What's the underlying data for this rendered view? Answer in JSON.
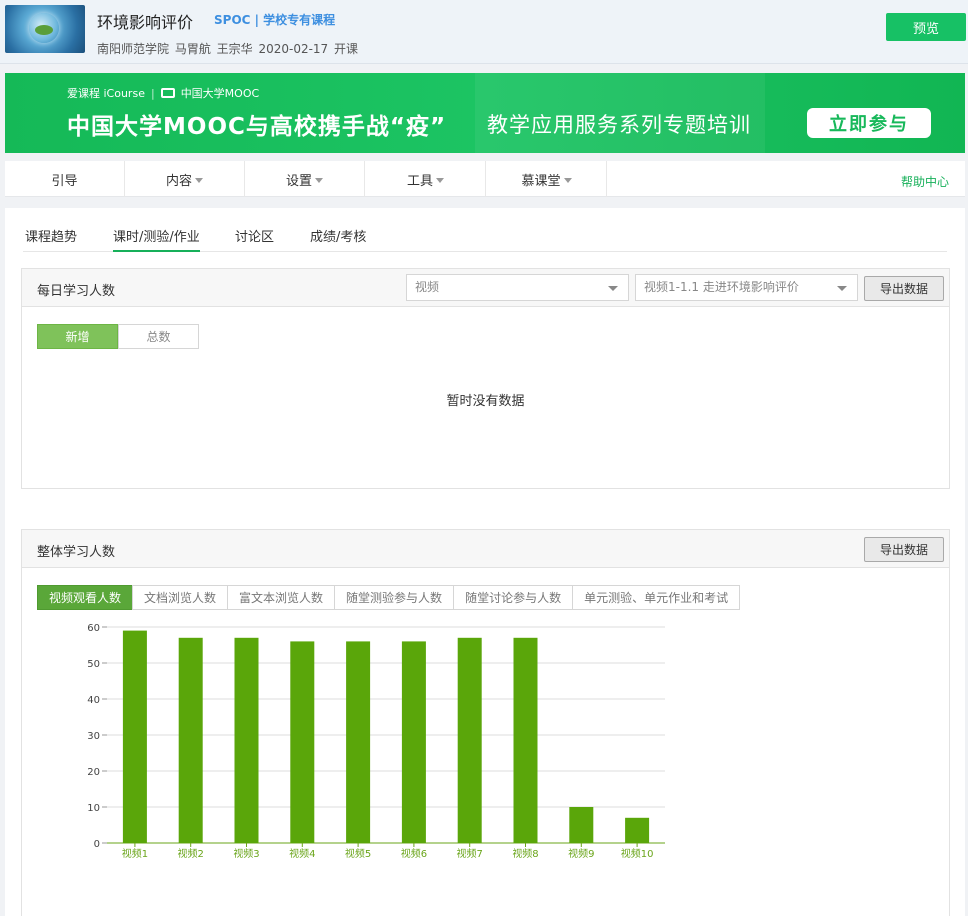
{
  "header": {
    "course_title": "环境影响评价",
    "course_tag": "SPOC | 学校专有课程",
    "course_meta": "南阳师范学院   马胃航 王宗华    2020-02-17 开课",
    "preview_label": "预览"
  },
  "banner": {
    "logo_left": "爱课程 iCourse",
    "logo_right": "中国大学MOOC",
    "headline": "中国大学MOOC与高校携手战“疫”",
    "subline": "教学应用服务系列专题培训",
    "join_label": "立即参与"
  },
  "nav": {
    "items": [
      {
        "label": "引导",
        "has_caret": false
      },
      {
        "label": "内容",
        "has_caret": true
      },
      {
        "label": "设置",
        "has_caret": true
      },
      {
        "label": "工具",
        "has_caret": true
      },
      {
        "label": "慕课堂",
        "has_caret": true
      }
    ],
    "help_label": "帮助中心"
  },
  "tabs": [
    {
      "label": "课程趋势",
      "active": false
    },
    {
      "label": "课时/测验/作业",
      "active": true
    },
    {
      "label": "讨论区",
      "active": false
    },
    {
      "label": "成绩/考核",
      "active": false
    }
  ],
  "daily_panel": {
    "title": "每日学习人数",
    "select_type": "视频",
    "select_item": "视频1-1.1 走进环境影响评价",
    "export_label": "导出数据",
    "toggle": [
      "新增",
      "总数"
    ],
    "empty_text": "暂时没有数据"
  },
  "overall_panel": {
    "title": "整体学习人数",
    "export_label": "导出数据",
    "subtabs": [
      "视频观看人数",
      "文档浏览人数",
      "富文本浏览人数",
      "随堂测验参与人数",
      "随堂讨论参与人数",
      "单元测验、单元作业和考试"
    ]
  },
  "colors": {
    "accent": "#17c165",
    "bar": "#5aa60a",
    "tick_text": "#6aa51a"
  },
  "chart_data": {
    "type": "bar",
    "categories": [
      "视频1",
      "视频2",
      "视频3",
      "视频4",
      "视频5",
      "视频6",
      "视频7",
      "视频8",
      "视频9",
      "视频10"
    ],
    "values": [
      59,
      57,
      57,
      56,
      56,
      56,
      57,
      57,
      10,
      7
    ],
    "yticks": [
      0,
      10,
      20,
      30,
      40,
      50,
      60
    ],
    "ylim": [
      0,
      60
    ],
    "grid": true,
    "title": "",
    "xlabel": "",
    "ylabel": ""
  }
}
